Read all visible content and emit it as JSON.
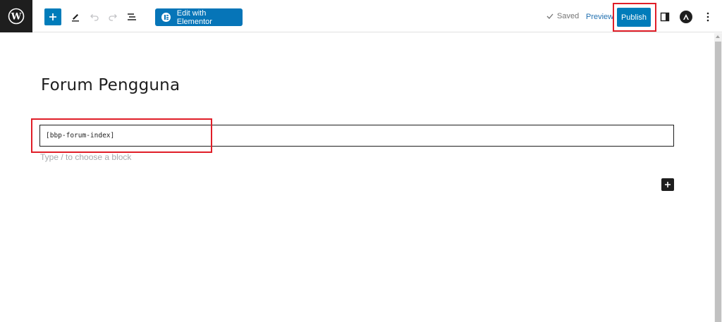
{
  "toolbar": {
    "icons": {
      "logo": "wordpress-icon",
      "add": "plus-icon",
      "tools": "pencil-icon",
      "undo": "undo-icon",
      "redo": "redo-icon",
      "list_view": "list-view-icon",
      "settings": "sidebar-toggle-icon",
      "avatar": "astra-icon",
      "options": "more-vertical-icon"
    },
    "elementor_label": "Edit with Elementor",
    "saved_label": "Saved",
    "preview_label": "Preview",
    "publish_label": "Publish"
  },
  "editor": {
    "page_title": "Forum Pengguna",
    "shortcode_value": "[bbp-forum-index]",
    "block_placeholder": "Type / to choose a block"
  },
  "colors": {
    "accent": "#007cba",
    "highlight": "#e01e28",
    "dark": "#1e1e1e"
  }
}
